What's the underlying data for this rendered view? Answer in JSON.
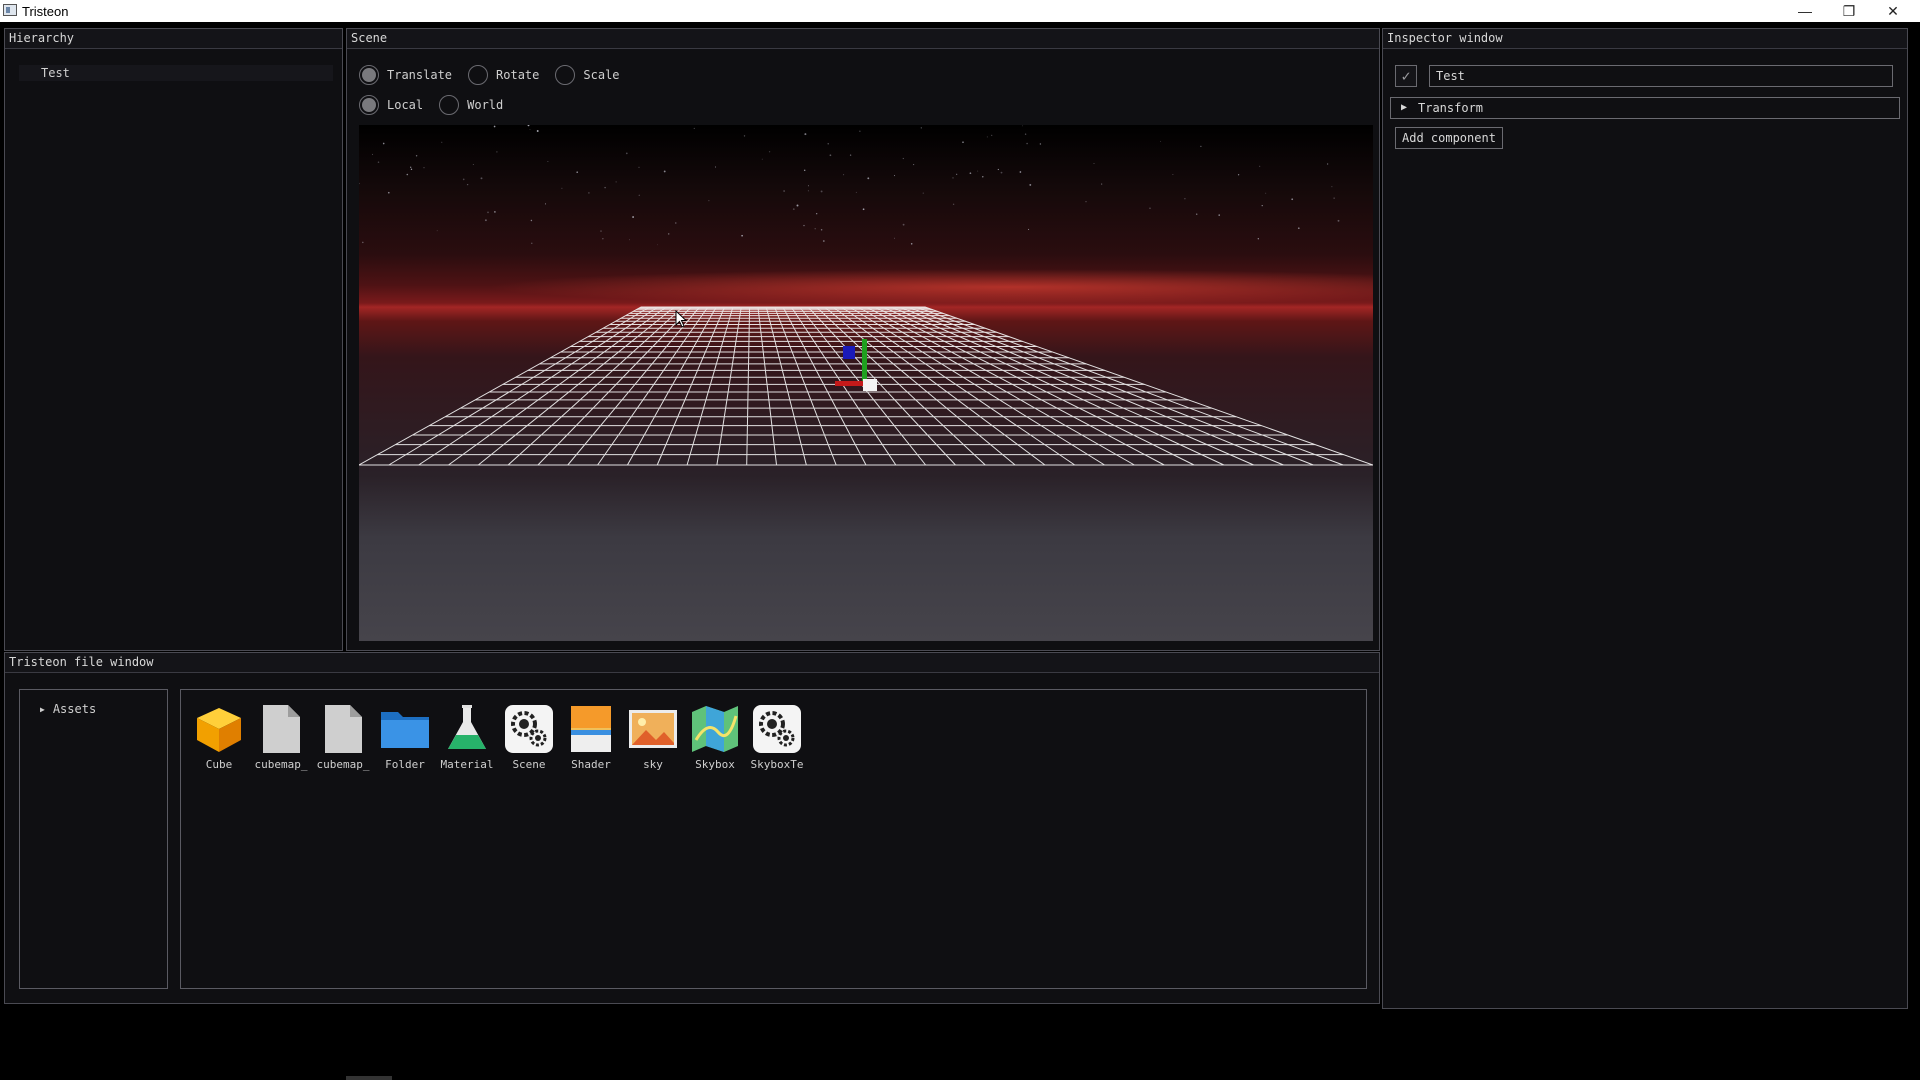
{
  "window": {
    "title": "Tristeon",
    "minimize_glyph": "—",
    "maximize_glyph": "❐",
    "close_glyph": "✕"
  },
  "hierarchy": {
    "title": "Hierarchy",
    "items": [
      {
        "label": "Test"
      }
    ]
  },
  "scene": {
    "title": "Scene",
    "transform_modes": [
      {
        "label": "Translate",
        "selected": true
      },
      {
        "label": "Rotate",
        "selected": false
      },
      {
        "label": "Scale",
        "selected": false
      }
    ],
    "space_modes": [
      {
        "label": "Local",
        "selected": true
      },
      {
        "label": "World",
        "selected": false
      }
    ]
  },
  "inspector": {
    "title": "Inspector window",
    "object_enabled_glyph": "✓",
    "object_name": "Test",
    "components": [
      {
        "label": "Transform",
        "collapsed_glyph": "▶"
      }
    ],
    "add_component_label": "Add component"
  },
  "file_window": {
    "title": "Tristeon file window",
    "tree": [
      {
        "label": "Assets",
        "arrow_glyph": "▶"
      }
    ],
    "assets": [
      {
        "label": "Cube",
        "icon": "cube-icon"
      },
      {
        "label": "cubemap_",
        "icon": "file-icon"
      },
      {
        "label": "cubemap_",
        "icon": "file-icon"
      },
      {
        "label": "Folder",
        "icon": "folder-icon"
      },
      {
        "label": "Material",
        "icon": "flask-icon"
      },
      {
        "label": "Scene",
        "icon": "gears-icon"
      },
      {
        "label": "Shader",
        "icon": "shader-icon"
      },
      {
        "label": "sky",
        "icon": "image-icon"
      },
      {
        "label": "Skybox",
        "icon": "map-icon"
      },
      {
        "label": "SkyboxTe",
        "icon": "gears-icon"
      }
    ]
  },
  "colors": {
    "panel_bg": "#0f0f12",
    "panel_border": "#4a4a52",
    "horizon_red": "#a32625",
    "gizmo_x": "#c41a1a",
    "gizmo_y": "#1fa01f",
    "gizmo_z": "#1a1ab8"
  }
}
